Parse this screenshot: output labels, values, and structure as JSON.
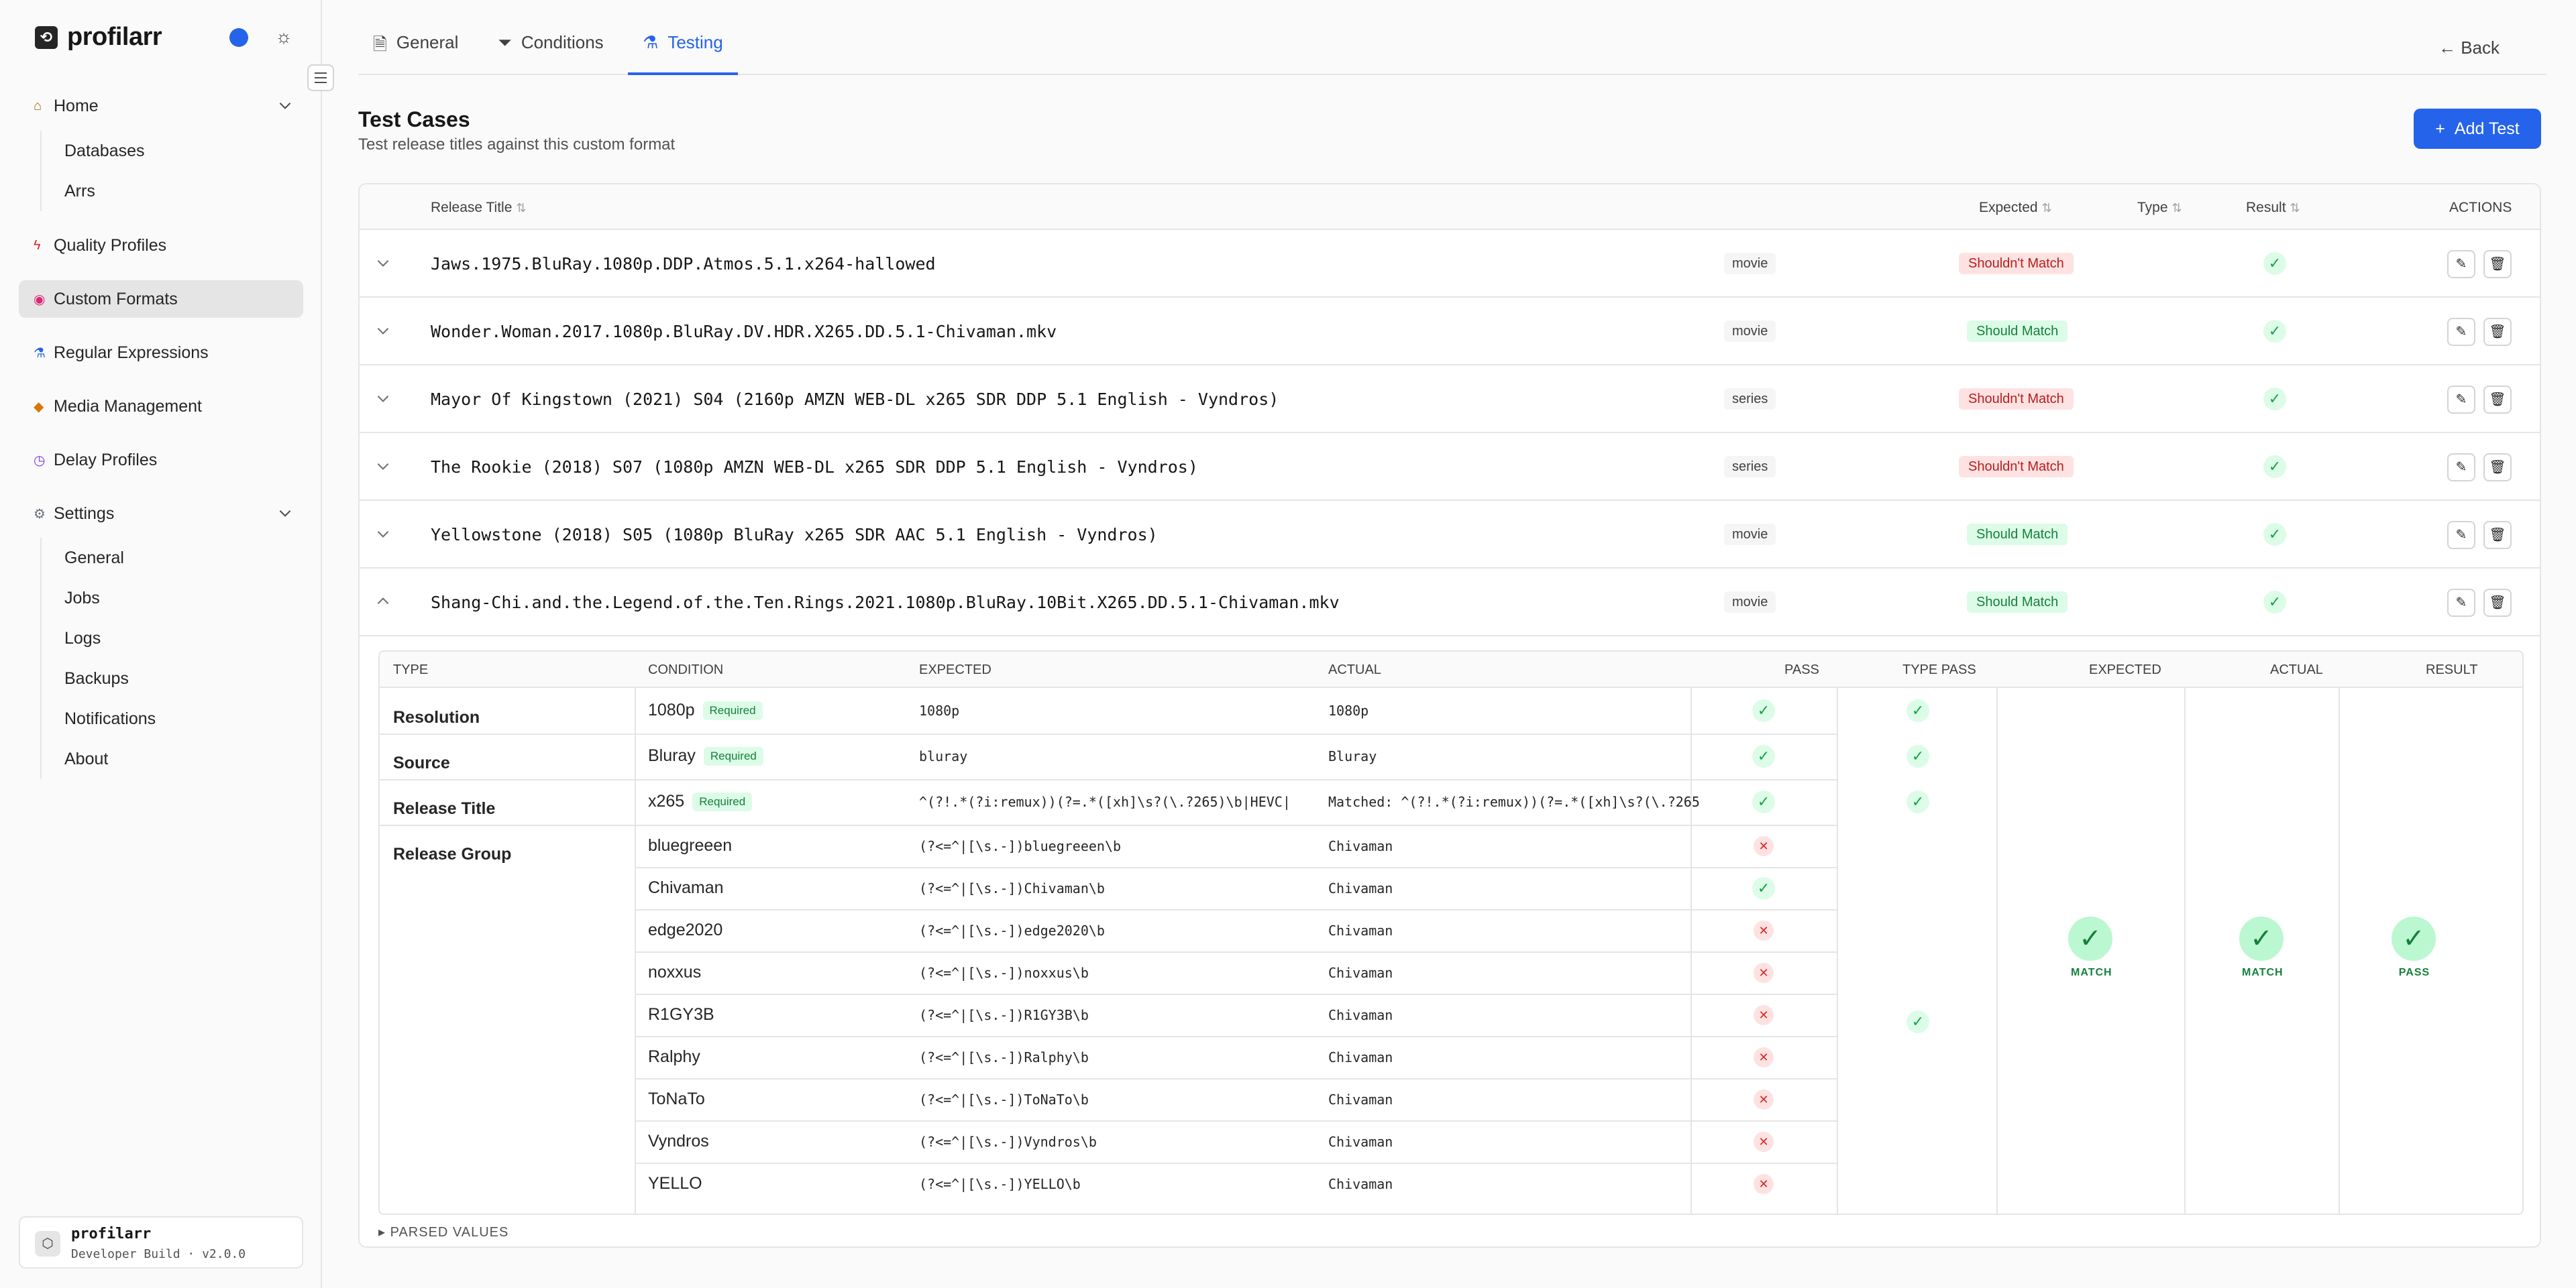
{
  "app": {
    "name": "profilarr",
    "version_label": "Developer Build · v2.0.0",
    "user_label": "profilarr"
  },
  "colors": {
    "accent": "#2563eb",
    "success": "#16a34a",
    "danger": "#dc2626"
  },
  "sidebar": {
    "items": [
      {
        "label": "Home",
        "icon": "home-icon"
      },
      {
        "label": "Quality Profiles",
        "icon": "bolt-icon"
      },
      {
        "label": "Custom Formats",
        "icon": "palette-icon"
      },
      {
        "label": "Regular Expressions",
        "icon": "flask-icon"
      },
      {
        "label": "Media Management",
        "icon": "tag-icon"
      },
      {
        "label": "Delay Profiles",
        "icon": "clock-icon"
      },
      {
        "label": "Settings",
        "icon": "gear-icon"
      }
    ],
    "home_sub": [
      "Databases",
      "Arrs"
    ],
    "settings_sub": [
      "General",
      "Jobs",
      "Logs",
      "Backups",
      "Notifications",
      "About"
    ]
  },
  "tabs": [
    "General",
    "Conditions",
    "Testing"
  ],
  "back_label": "Back",
  "section": {
    "title": "Test Cases",
    "subtitle": "Test release titles against this custom format",
    "add_label": "Add Test"
  },
  "table": {
    "headers": {
      "title": "Release Title",
      "expected": "Expected",
      "type": "Type",
      "result": "Result",
      "actions": "ACTIONS"
    },
    "rows": [
      {
        "title": "Jaws.1975.BluRay.1080p.DDP.Atmos.5.1.x264-hallowed",
        "expected": "Shouldn't Match",
        "type": "movie"
      },
      {
        "title": "Wonder.Woman.2017.1080p.BluRay.DV.HDR.X265.DD.5.1-Chivaman.mkv",
        "expected": "Should Match",
        "type": "movie"
      },
      {
        "title": "Mayor Of Kingstown (2021) S04 (2160p AMZN WEB-DL x265 SDR DDP 5.1 English - Vyndros)",
        "expected": "Shouldn't Match",
        "type": "series"
      },
      {
        "title": "The Rookie (2018) S07 (1080p AMZN WEB-DL x265 SDR DDP 5.1 English - Vyndros)",
        "expected": "Shouldn't Match",
        "type": "series"
      },
      {
        "title": "Yellowstone (2018) S05 (1080p BluRay x265 SDR AAC 5.1 English - Vyndros)",
        "expected": "Should Match",
        "type": "movie"
      },
      {
        "title": "Shang-Chi.and.the.Legend.of.the.Ten.Rings.2021.1080p.BluRay.10Bit.X265.DD.5.1-Chivaman.mkv",
        "expected": "Should Match",
        "type": "movie"
      }
    ]
  },
  "detail": {
    "headers": {
      "type": "TYPE",
      "condition": "CONDITION",
      "expected": "EXPECTED",
      "actual": "ACTUAL",
      "pass": "PASS",
      "type_pass": "TYPE PASS",
      "expected2": "EXPECTED",
      "actual2": "ACTUAL",
      "result": "RESULT"
    },
    "types": [
      "Resolution",
      "Source",
      "Release Title",
      "Release Group"
    ],
    "required_label": "Required",
    "conditions": [
      {
        "name": "1080p",
        "required": true,
        "expected": "1080p",
        "actual": "1080p",
        "pass": true
      },
      {
        "name": "Bluray",
        "required": true,
        "expected": "bluray",
        "actual": "Bluray",
        "pass": true
      },
      {
        "name": "x265",
        "required": true,
        "expected": "^(?!.*(?i:remux))(?=.*([xh]\\s?(\\.?265)\\b|HEVC|",
        "actual": "Matched: ^(?!.*(?i:remux))(?=.*([xh]\\s?(\\.?265",
        "pass": true
      },
      {
        "name": "bluegreeen",
        "required": false,
        "expected": "(?<=^|[\\s.-])bluegreeen\\b",
        "actual": "Chivaman",
        "pass": false
      },
      {
        "name": "Chivaman",
        "required": false,
        "expected": "(?<=^|[\\s.-])Chivaman\\b",
        "actual": "Chivaman",
        "pass": true
      },
      {
        "name": "edge2020",
        "required": false,
        "expected": "(?<=^|[\\s.-])edge2020\\b",
        "actual": "Chivaman",
        "pass": false
      },
      {
        "name": "noxxus",
        "required": false,
        "expected": "(?<=^|[\\s.-])noxxus\\b",
        "actual": "Chivaman",
        "pass": false
      },
      {
        "name": "R1GY3B",
        "required": false,
        "expected": "(?<=^|[\\s.-])R1GY3B\\b",
        "actual": "Chivaman",
        "pass": false
      },
      {
        "name": "Ralphy",
        "required": false,
        "expected": "(?<=^|[\\s.-])Ralphy\\b",
        "actual": "Chivaman",
        "pass": false
      },
      {
        "name": "ToNaTo",
        "required": false,
        "expected": "(?<=^|[\\s.-])ToNaTo\\b",
        "actual": "Chivaman",
        "pass": false
      },
      {
        "name": "Vyndros",
        "required": false,
        "expected": "(?<=^|[\\s.-])Vyndros\\b",
        "actual": "Chivaman",
        "pass": false
      },
      {
        "name": "YELLO",
        "required": false,
        "expected": "(?<=^|[\\s.-])YELLO\\b",
        "actual": "Chivaman",
        "pass": false
      }
    ],
    "summary": {
      "expected": "MATCH",
      "actual": "MATCH",
      "result": "PASS"
    },
    "parsed_label": "▸ PARSED VALUES"
  }
}
